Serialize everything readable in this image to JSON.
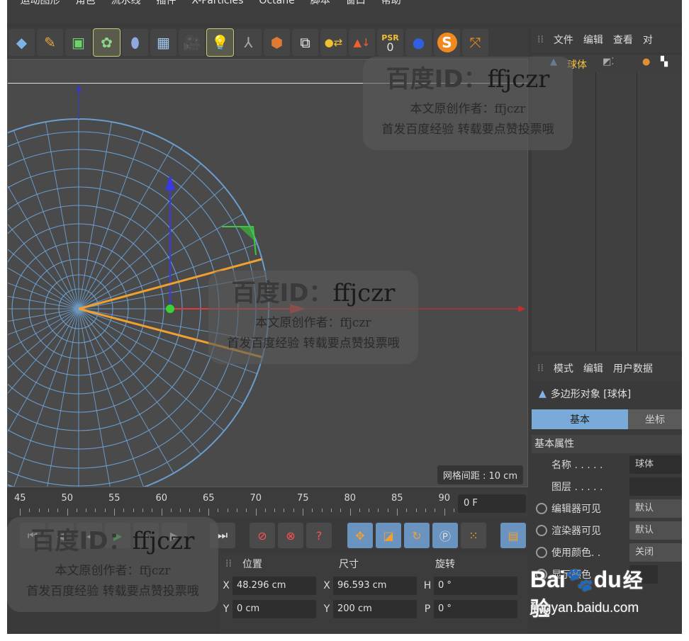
{
  "menu": {
    "items": [
      "运动图形",
      "角色",
      "流水线",
      "插件",
      "X-Particles",
      "Octane",
      "脚本",
      "窗口",
      "帮助"
    ]
  },
  "toolbar": {
    "buttons": [
      "cube-icon",
      "pen-icon",
      "subdivision-icon",
      "cloner-icon",
      "deformer-icon",
      "floor-icon",
      "camera-icon",
      "light-icon",
      "joint-icon",
      "extrude-icon",
      "sketch-icon",
      "xyz-icon",
      "axis-icon",
      "psr-icon",
      "morph-icon",
      "s-icon",
      "arrows-icon"
    ],
    "psr_label": "PSR",
    "psr_value": "0"
  },
  "viewport": {
    "grid_distance": "网格间距 : 10 cm"
  },
  "object_manager": {
    "tabs": [
      "文件",
      "编辑",
      "查看",
      "对"
    ],
    "object_name": "球体"
  },
  "attributes": {
    "tabs": [
      "模式",
      "编辑",
      "用户数据"
    ],
    "object_title": "多边形对象 [球体]",
    "page_tabs": [
      "基本",
      "坐标"
    ],
    "section": "基本属性",
    "props": [
      {
        "label": "名称 . . . . .",
        "value": "球体"
      },
      {
        "label": "图层 . . . . .",
        "value": ""
      },
      {
        "label": "编辑器可见",
        "value": "默认"
      },
      {
        "label": "渲染器可见",
        "value": "默认"
      },
      {
        "label": "使用颜色. .",
        "value": "关闭"
      },
      {
        "label": "显示颜色",
        "value": ""
      }
    ]
  },
  "timeline": {
    "ticks": [
      "45",
      "50",
      "55",
      "60",
      "65",
      "70",
      "75",
      "80",
      "85",
      "90"
    ],
    "frame": "0 F"
  },
  "coordinates": {
    "headers": [
      "位置",
      "尺寸",
      "旋转"
    ],
    "rows": [
      {
        "pos_axis": "X",
        "pos": "48.296 cm",
        "size_axis": "X",
        "size": "96.593 cm",
        "rot_axis": "H",
        "rot": "0 °"
      },
      {
        "pos_axis": "Y",
        "pos": "0 cm",
        "size_axis": "Y",
        "size": "200 cm",
        "rot_axis": "P",
        "rot": "0 °"
      }
    ]
  },
  "watermark": {
    "id_label": "百度ID：",
    "id_value": "ffjczr",
    "line1": "本文原创作者：ffjczr",
    "line2": "首发百度经验 转载要点赞投票哦"
  },
  "baidu": {
    "brand": "Bai",
    "brand2": "du",
    "jingyan": "经验",
    "url": "jingyan.baidu.com"
  }
}
